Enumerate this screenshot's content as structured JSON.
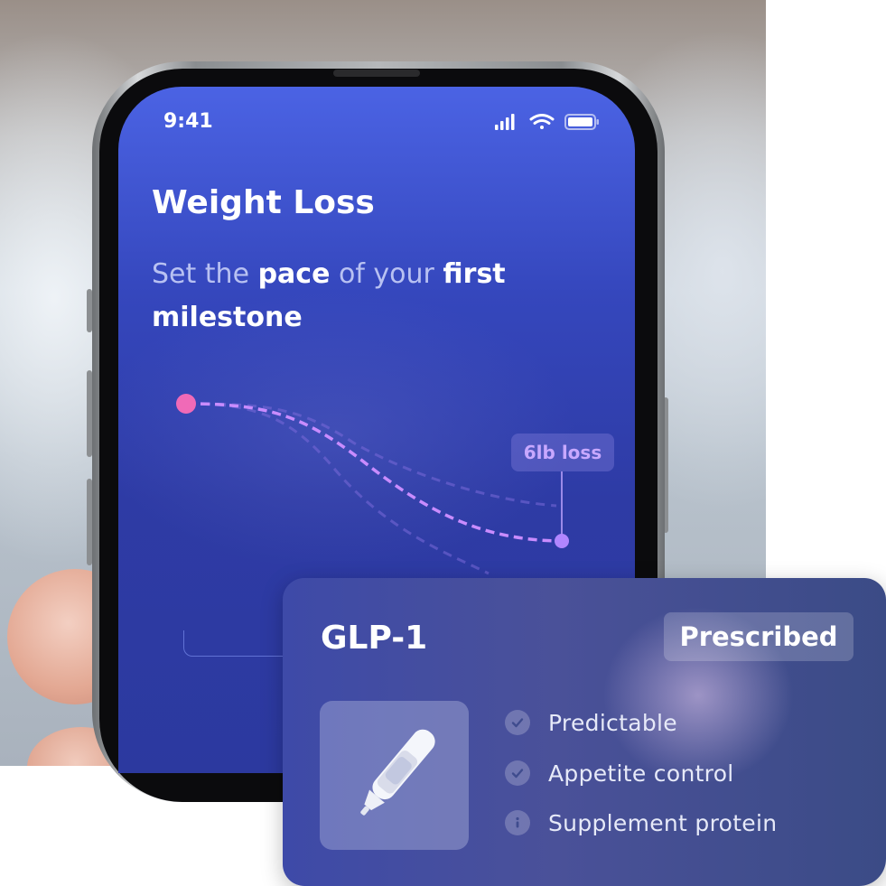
{
  "status_bar": {
    "time": "9:41"
  },
  "screen": {
    "title": "Weight Loss",
    "subtitle": {
      "t1": "Set the ",
      "b1": "pace",
      "t2": " of your ",
      "b2": "first milestone"
    },
    "chart_tooltip": "6lb loss"
  },
  "card": {
    "title": "GLP-1",
    "badge": "Prescribed",
    "benefits": [
      {
        "label": "Predictable",
        "icon": "check-circle-icon"
      },
      {
        "label": "Appetite control",
        "icon": "check-circle-icon"
      },
      {
        "label": "Supplement protein",
        "icon": "info-circle-icon"
      }
    ]
  },
  "colors": {
    "screen_top": "#4b63e4",
    "screen_bottom": "#2c399f",
    "start_dot": "#f06ab7",
    "end_dot": "#b186ff",
    "tooltip_text": "#c8a8ff"
  }
}
